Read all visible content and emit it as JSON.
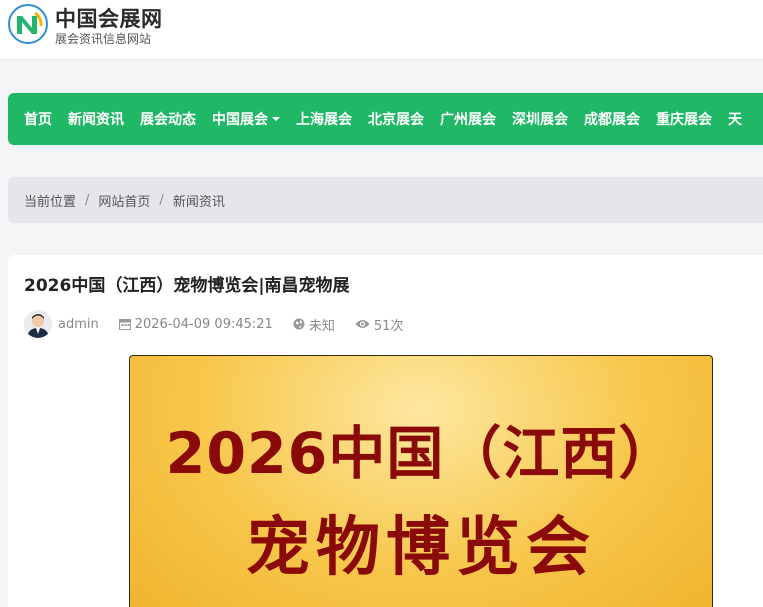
{
  "header": {
    "site_name": "中国会展网",
    "tagline": "展会资讯信息网站"
  },
  "nav": {
    "items": [
      {
        "label": "首页"
      },
      {
        "label": "新闻资讯"
      },
      {
        "label": "展会动态"
      },
      {
        "label": "中国展会",
        "has_dropdown": true
      },
      {
        "label": "上海展会"
      },
      {
        "label": "北京展会"
      },
      {
        "label": "广州展会"
      },
      {
        "label": "深圳展会"
      },
      {
        "label": "成都展会"
      },
      {
        "label": "重庆展会"
      },
      {
        "label": "天"
      }
    ]
  },
  "breadcrumb": {
    "items": [
      "当前位置",
      "网站首页",
      "新闻资讯"
    ],
    "separator": "/"
  },
  "article": {
    "title": "2026中国（江西）宠物博览会|南昌宠物展",
    "author": "admin",
    "datetime": "2026-04-09 09:45:21",
    "location": "未知",
    "views": "51次",
    "poster_line1": "2026中国（江西）",
    "poster_line2": "宠物博览会"
  },
  "colors": {
    "nav_bg": "#20b866",
    "poster_text": "#8a0a0a",
    "poster_bg": "#f7c649"
  }
}
